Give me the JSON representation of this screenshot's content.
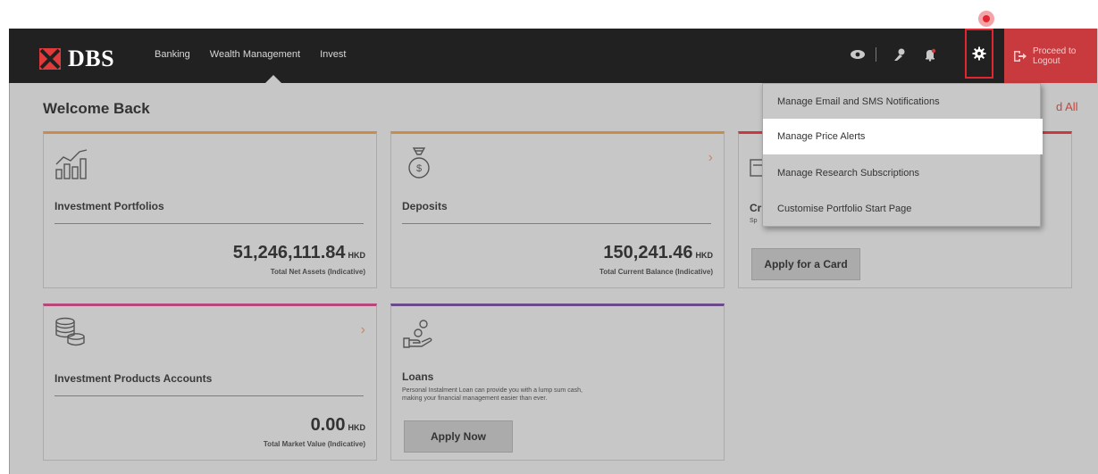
{
  "brand": {
    "name": "DBS"
  },
  "nav": {
    "items": [
      {
        "label": "Banking"
      },
      {
        "label": "Wealth Management"
      },
      {
        "label": "Invest"
      }
    ]
  },
  "header": {
    "icons": [
      "eye-icon",
      "user-pin-icon",
      "bell-icon",
      "gear-icon"
    ],
    "logout_label_line1": "Proceed to",
    "logout_label_line2": "Logout"
  },
  "dropdown": {
    "items": [
      {
        "label": "Manage Email and SMS Notifications"
      },
      {
        "label": "Manage Price Alerts",
        "highlighted": true
      },
      {
        "label": "Manage Research Subscriptions"
      },
      {
        "label": "Customise Portfolio Start Page"
      }
    ]
  },
  "main": {
    "welcome": "Welcome Back",
    "read_all": "d All",
    "cards": {
      "investment_portfolios": {
        "title": "Investment Portfolios",
        "amount": "51,246,111.84",
        "currency": "HKD",
        "sub": "Total Net Assets (Indicative)"
      },
      "deposits": {
        "title": "Deposits",
        "amount": "150,241.46",
        "currency": "HKD",
        "sub": "Total Current Balance (Indicative)"
      },
      "cards": {
        "title_partial": "Cr",
        "sub_partial": "Sp",
        "apply": "Apply for a Card"
      },
      "investment_products": {
        "title": "Investment Products Accounts",
        "amount": "0.00",
        "currency": "HKD",
        "sub": "Total Market Value (Indicative)"
      },
      "loans": {
        "title": "Loans",
        "desc_line1": "Personal Instalment Loan can provide you with a lump sum cash,",
        "desc_line2": "making your financial management easier than ever.",
        "apply": "Apply Now"
      }
    }
  },
  "colors": {
    "topbar": "#222122",
    "accent_red": "#e2262f",
    "logout_bg": "#c83a3e",
    "card_orange": "#c98c4d",
    "card_pink": "#b5477a",
    "card_purple": "#6b4a8a"
  }
}
